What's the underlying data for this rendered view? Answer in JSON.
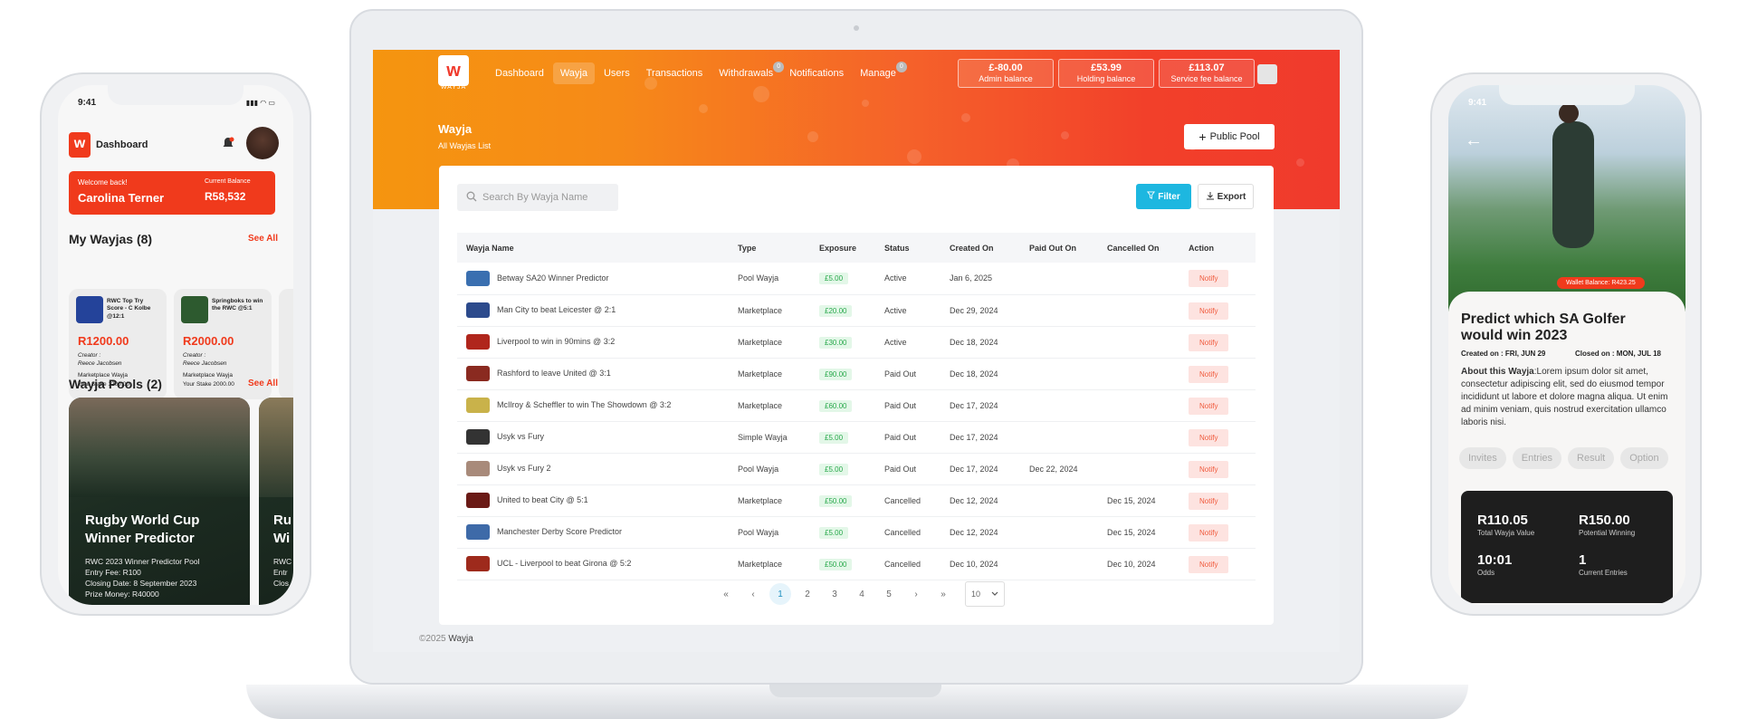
{
  "laptop": {
    "brand": {
      "logo_letter": "w",
      "logo_text": "WAYJA"
    },
    "nav": [
      {
        "label": "Dashboard",
        "active": false,
        "badge": ""
      },
      {
        "label": "Wayja",
        "active": true,
        "badge": ""
      },
      {
        "label": "Users",
        "active": false,
        "badge": ""
      },
      {
        "label": "Transactions",
        "active": false,
        "badge": ""
      },
      {
        "label": "Withdrawals",
        "active": false,
        "badge": "0"
      },
      {
        "label": "Notifications",
        "active": false,
        "badge": ""
      },
      {
        "label": "Manage",
        "active": false,
        "badge": "0"
      }
    ],
    "balances": [
      {
        "value": "£-80.00",
        "label": "Admin balance"
      },
      {
        "value": "£53.99",
        "label": "Holding balance"
      },
      {
        "value": "£113.07",
        "label": "Service fee balance"
      }
    ],
    "page_title": "Wayja",
    "page_subtitle": "All Wayjas List",
    "public_pool_label": "Public Pool",
    "search_placeholder": "Search By Wayja Name",
    "filter_label": "Filter",
    "export_label": "Export",
    "columns": [
      "Wayja Name",
      "Type",
      "Exposure",
      "Status",
      "Created On",
      "Paid Out On",
      "Cancelled On",
      "Action"
    ],
    "rows": [
      {
        "name": "Betway SA20 Winner Predictor",
        "type": "Pool Wayja",
        "exposure": "£5.00",
        "status": "Active",
        "created": "Jan 6, 2025",
        "paid_out": "",
        "cancelled": "",
        "action": "Notify",
        "thumb": "#3a6fb0"
      },
      {
        "name": "Man City to beat Leicester @ 2:1",
        "type": "Marketplace",
        "exposure": "£20.00",
        "status": "Active",
        "created": "Dec 29, 2024",
        "paid_out": "",
        "cancelled": "",
        "action": "Notify",
        "thumb": "#2c4a8c"
      },
      {
        "name": "Liverpool to win in 90mins @ 3:2",
        "type": "Marketplace",
        "exposure": "£30.00",
        "status": "Active",
        "created": "Dec 18, 2024",
        "paid_out": "",
        "cancelled": "",
        "action": "Notify",
        "thumb": "#b0261c"
      },
      {
        "name": "Rashford to leave United @ 3:1",
        "type": "Marketplace",
        "exposure": "£90.00",
        "status": "Paid Out",
        "created": "Dec 18, 2024",
        "paid_out": "",
        "cancelled": "",
        "action": "Notify",
        "thumb": "#8a2a20"
      },
      {
        "name": "McIlroy & Scheffler to win The Showdown @ 3:2",
        "type": "Marketplace",
        "exposure": "£60.00",
        "status": "Paid Out",
        "created": "Dec 17, 2024",
        "paid_out": "",
        "cancelled": "",
        "action": "Notify",
        "thumb": "#c9b24a"
      },
      {
        "name": "Usyk vs Fury",
        "type": "Simple Wayja",
        "exposure": "£5.00",
        "status": "Paid Out",
        "created": "Dec 17, 2024",
        "paid_out": "",
        "cancelled": "",
        "action": "Notify",
        "thumb": "#333333"
      },
      {
        "name": "Usyk vs Fury 2",
        "type": "Pool Wayja",
        "exposure": "£5.00",
        "status": "Paid Out",
        "created": "Dec 17, 2024",
        "paid_out": "Dec 22, 2024",
        "cancelled": "",
        "action": "Notify",
        "thumb": "#a88a7a"
      },
      {
        "name": "United to beat City @ 5:1",
        "type": "Marketplace",
        "exposure": "£50.00",
        "status": "Cancelled",
        "created": "Dec 12, 2024",
        "paid_out": "",
        "cancelled": "Dec 15, 2024",
        "action": "Notify",
        "thumb": "#6a1a16"
      },
      {
        "name": "Manchester Derby Score Predictor",
        "type": "Pool Wayja",
        "exposure": "£5.00",
        "status": "Cancelled",
        "created": "Dec 12, 2024",
        "paid_out": "",
        "cancelled": "Dec 15, 2024",
        "action": "Notify",
        "thumb": "#3e6aa8"
      },
      {
        "name": "UCL - Liverpool to beat Girona @ 5:2",
        "type": "Marketplace",
        "exposure": "£50.00",
        "status": "Cancelled",
        "created": "Dec 10, 2024",
        "paid_out": "",
        "cancelled": "Dec 10, 2024",
        "action": "Notify",
        "thumb": "#9e2a1c"
      }
    ],
    "pagination": {
      "first": "«",
      "prev": "‹",
      "pages": [
        "1",
        "2",
        "3",
        "4",
        "5"
      ],
      "current": "1",
      "next": "›",
      "last": "»",
      "page_size": "10"
    },
    "footer_year": "©2025",
    "footer_brand": "Wayja"
  },
  "left_phone": {
    "time": "9:41",
    "header_title": "Dashboard",
    "welcome": "Welcome back!",
    "user_name": "Carolina Terner",
    "balance_label": "Current Balance",
    "balance_value": "R58,532",
    "my_wayjas_title": "My Wayjas (8)",
    "see_all": "See All",
    "wayja_cards": [
      {
        "title": "RWC Top Try Score - C Kolbe @12:1",
        "amount": "R1200.00",
        "creator_label": "Creator :",
        "creator": "Reece Jacobsen",
        "kind": "Marketplace Wayja",
        "stake": "Your Stake 1200.00"
      },
      {
        "title": "Springboks to win the RWC @5:1",
        "amount": "R2000.00",
        "creator_label": "Creator :",
        "creator": "Reece Jacobsen",
        "kind": "Marketplace Wayja",
        "stake": "Your Stake 2000.00"
      }
    ],
    "pools_title": "Wayja Pools (2)",
    "pool": {
      "title": "Rugby World Cup Winner Predictor",
      "l1": "RWC 2023 Winner Predictor Pool",
      "l2": "Entry Fee: R100",
      "l3": "Closing Date: 8 September 2023",
      "l4": "Prize Money: R40000"
    },
    "pool2_title": "Ru Wi",
    "pool2_lines": [
      "RWC",
      "Entr",
      "Clos"
    ]
  },
  "right_phone": {
    "time": "9:41",
    "wallet": "Wallet Balance: R423.25",
    "title": "Predict which SA Golfer would win 2023",
    "created_label": "Created on :",
    "created": "FRI, JUN 29",
    "closed_label": "Closed on :",
    "closed": "MON, JUL 18",
    "about_label": "About this Wayja",
    "about_text": ":Lorem ipsum dolor sit amet, consectetur adipiscing elit, sed do eiusmod tempor incididunt ut labore et dolore magna aliqua. Ut enim ad minim veniam, quis nostrud exercitation ullamco laboris nisi.",
    "tabs": [
      "Invites",
      "Entries",
      "Result",
      "Option"
    ],
    "stats": [
      {
        "value": "R110.05",
        "label": "Total Wayja Value"
      },
      {
        "value": "R150.00",
        "label": "Potential Winning"
      },
      {
        "value": "10:01",
        "label": "Odds"
      },
      {
        "value": "1",
        "label": "Current Entries"
      }
    ]
  },
  "colors": {
    "brand_orange": "#f5950f",
    "brand_red": "#f03a2c",
    "filter_blue": "#1db7e0"
  }
}
